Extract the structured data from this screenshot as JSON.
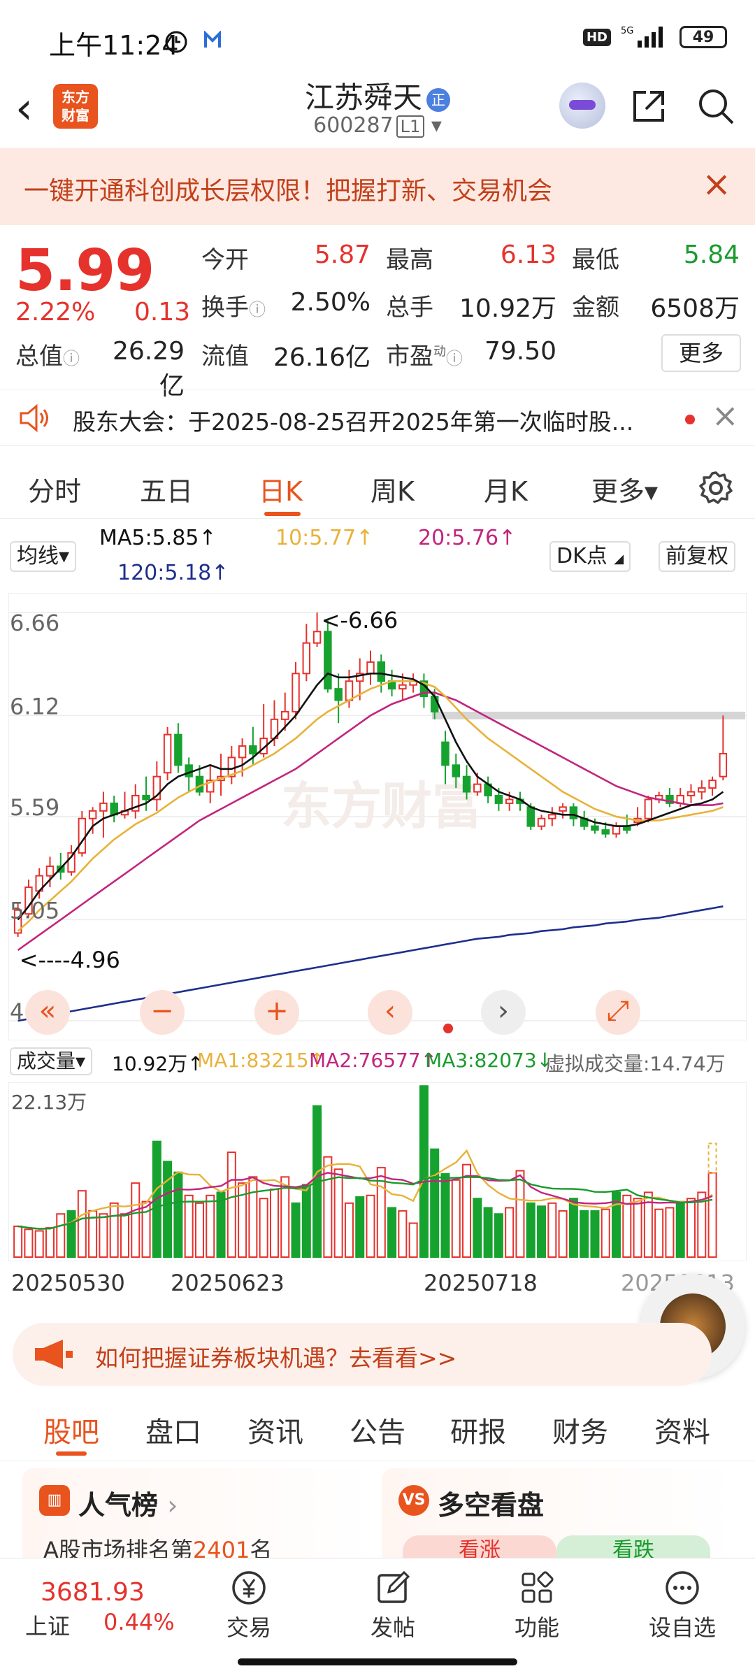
{
  "status_bar": {
    "time": "上午11:24",
    "hd": "HD",
    "network": "5G",
    "battery": "49"
  },
  "header": {
    "back": "‹",
    "logo_line1": "东方",
    "logo_line2": "财富",
    "stock_name": "江苏舜天",
    "badge": "正",
    "stock_code": "600287",
    "level": "L1"
  },
  "promo": {
    "text": "一键开通科创成长层权限！把握打新、交易机会",
    "close": "×"
  },
  "quote": {
    "price": "5.99",
    "change_pct": "2.22%",
    "change": "0.13",
    "open_label": "今开",
    "open": "5.87",
    "high_label": "最高",
    "high": "6.13",
    "low_label": "最低",
    "low": "5.84",
    "turnover_label": "换手",
    "turnover": "2.50%",
    "volume_label": "总手",
    "volume": "10.92万",
    "amount_label": "金额",
    "amount": "6508万",
    "mktcap_label": "总值",
    "mktcap": "26.29亿",
    "float_label": "流值",
    "float": "26.16亿",
    "pe_label": "市盈",
    "pe_sup": "动",
    "pe": "79.50",
    "more": "更多"
  },
  "announcement": {
    "text": "股东大会：于2025-08-25召开2025年第一次临时股...",
    "close": "×"
  },
  "chart_tabs": [
    "分时",
    "五日",
    "日K",
    "周K",
    "月K",
    "更多▾"
  ],
  "ma_legend": {
    "selector": "均线▾",
    "ma5": "MA5:5.85↑",
    "ma10": "10:5.77↑",
    "ma20": "20:5.76↑",
    "ma120": "120:5.18↑",
    "dk": "DK点",
    "adjust": "前复权",
    "colors": {
      "ma5": "#111111",
      "ma10": "#e8b23a",
      "ma20": "#c2257e",
      "ma120": "#1e2f8c"
    }
  },
  "chart_data": {
    "type": "candlestick",
    "y_ticks": [
      "6.66",
      "6.12",
      "5.59",
      "5.05",
      "4.52"
    ],
    "ylim": [
      4.52,
      6.66
    ],
    "max_label": "6.66",
    "min_label": "4.96",
    "candles": [
      [
        4.98,
        5.1,
        5.14,
        4.96
      ],
      [
        5.08,
        5.22,
        5.26,
        5.06
      ],
      [
        5.2,
        5.28,
        5.32,
        5.16
      ],
      [
        5.28,
        5.33,
        5.38,
        5.22
      ],
      [
        5.33,
        5.3,
        5.4,
        5.26
      ],
      [
        5.3,
        5.4,
        5.44,
        5.28
      ],
      [
        5.4,
        5.58,
        5.62,
        5.38
      ],
      [
        5.58,
        5.62,
        5.64,
        5.5
      ],
      [
        5.62,
        5.66,
        5.72,
        5.48
      ],
      [
        5.66,
        5.6,
        5.7,
        5.56
      ],
      [
        5.6,
        5.62,
        5.72,
        5.58
      ],
      [
        5.62,
        5.7,
        5.76,
        5.58
      ],
      [
        5.7,
        5.68,
        5.8,
        5.62
      ],
      [
        5.68,
        5.8,
        5.88,
        5.62
      ],
      [
        5.82,
        6.02,
        6.06,
        5.78
      ],
      [
        6.02,
        5.86,
        6.08,
        5.82
      ],
      [
        5.86,
        5.8,
        5.9,
        5.72
      ],
      [
        5.8,
        5.72,
        5.86,
        5.7
      ],
      [
        5.72,
        5.78,
        5.86,
        5.66
      ],
      [
        5.78,
        5.8,
        5.92,
        5.7
      ],
      [
        5.8,
        5.9,
        5.96,
        5.76
      ],
      [
        5.9,
        5.96,
        6.0,
        5.8
      ],
      [
        5.96,
        5.92,
        6.06,
        5.86
      ],
      [
        5.92,
        6.0,
        6.18,
        5.9
      ],
      [
        6.0,
        6.1,
        6.2,
        5.96
      ],
      [
        6.1,
        6.14,
        6.24,
        6.04
      ],
      [
        6.14,
        6.34,
        6.4,
        6.1
      ],
      [
        6.34,
        6.5,
        6.6,
        6.3
      ],
      [
        6.5,
        6.56,
        6.66,
        6.48
      ],
      [
        6.56,
        6.26,
        6.62,
        6.24
      ],
      [
        6.26,
        6.2,
        6.34,
        6.08
      ],
      [
        6.2,
        6.3,
        6.36,
        6.16
      ],
      [
        6.3,
        6.34,
        6.42,
        6.2
      ],
      [
        6.34,
        6.4,
        6.46,
        6.28
      ],
      [
        6.4,
        6.3,
        6.44,
        6.24
      ],
      [
        6.3,
        6.26,
        6.36,
        6.22
      ],
      [
        6.26,
        6.28,
        6.34,
        6.2
      ],
      [
        6.28,
        6.3,
        6.34,
        6.24
      ],
      [
        6.3,
        6.22,
        6.34,
        6.16
      ],
      [
        6.22,
        6.14,
        6.26,
        6.1
      ],
      [
        5.98,
        5.86,
        6.04,
        5.76
      ],
      [
        5.86,
        5.8,
        5.92,
        5.74
      ],
      [
        5.8,
        5.72,
        5.86,
        5.68
      ],
      [
        5.72,
        5.76,
        5.82,
        5.7
      ],
      [
        5.76,
        5.7,
        5.8,
        5.66
      ],
      [
        5.7,
        5.66,
        5.74,
        5.62
      ],
      [
        5.66,
        5.68,
        5.72,
        5.62
      ],
      [
        5.68,
        5.66,
        5.72,
        5.62
      ],
      [
        5.64,
        5.54,
        5.66,
        5.52
      ],
      [
        5.54,
        5.58,
        5.6,
        5.52
      ],
      [
        5.58,
        5.6,
        5.64,
        5.54
      ],
      [
        5.62,
        5.64,
        5.66,
        5.58
      ],
      [
        5.64,
        5.58,
        5.66,
        5.54
      ],
      [
        5.58,
        5.54,
        5.62,
        5.52
      ],
      [
        5.54,
        5.52,
        5.58,
        5.5
      ],
      [
        5.52,
        5.5,
        5.56,
        5.48
      ],
      [
        5.5,
        5.54,
        5.56,
        5.48
      ],
      [
        5.54,
        5.52,
        5.6,
        5.5
      ],
      [
        5.56,
        5.58,
        5.64,
        5.54
      ],
      [
        5.58,
        5.68,
        5.7,
        5.56
      ],
      [
        5.68,
        5.7,
        5.72,
        5.66
      ],
      [
        5.7,
        5.66,
        5.74,
        5.64
      ],
      [
        5.66,
        5.7,
        5.74,
        5.64
      ],
      [
        5.7,
        5.72,
        5.76,
        5.66
      ],
      [
        5.72,
        5.74,
        5.78,
        5.68
      ],
      [
        5.74,
        5.78,
        5.8,
        5.7
      ],
      [
        5.8,
        5.92,
        6.12,
        5.78
      ]
    ],
    "ma5": [
      5.05,
      5.12,
      5.2,
      5.26,
      5.32,
      5.38,
      5.46,
      5.54,
      5.58,
      5.6,
      5.62,
      5.64,
      5.66,
      5.7,
      5.76,
      5.8,
      5.82,
      5.84,
      5.86,
      5.84,
      5.84,
      5.86,
      5.9,
      5.95,
      6.0,
      6.06,
      6.12,
      6.2,
      6.28,
      6.34,
      6.32,
      6.32,
      6.33,
      6.34,
      6.34,
      6.33,
      6.32,
      6.31,
      6.28,
      6.22,
      6.1,
      5.98,
      5.88,
      5.8,
      5.76,
      5.72,
      5.7,
      5.68,
      5.64,
      5.62,
      5.61,
      5.6,
      5.6,
      5.58,
      5.56,
      5.55,
      5.54,
      5.54,
      5.55,
      5.57,
      5.59,
      5.61,
      5.63,
      5.65,
      5.66,
      5.68,
      5.72
    ],
    "ma10": [
      4.99,
      5.04,
      5.1,
      5.15,
      5.2,
      5.25,
      5.31,
      5.37,
      5.42,
      5.47,
      5.51,
      5.55,
      5.58,
      5.61,
      5.65,
      5.69,
      5.72,
      5.75,
      5.77,
      5.79,
      5.81,
      5.83,
      5.86,
      5.89,
      5.92,
      5.96,
      6.0,
      6.05,
      6.1,
      6.14,
      6.17,
      6.2,
      6.23,
      6.26,
      6.28,
      6.3,
      6.3,
      6.3,
      6.29,
      6.27,
      6.22,
      6.16,
      6.1,
      6.05,
      6.0,
      5.96,
      5.92,
      5.88,
      5.84,
      5.8,
      5.76,
      5.72,
      5.69,
      5.66,
      5.63,
      5.61,
      5.59,
      5.58,
      5.57,
      5.57,
      5.57,
      5.58,
      5.59,
      5.6,
      5.61,
      5.62,
      5.64
    ],
    "ma20": [
      4.89,
      4.93,
      4.97,
      5.01,
      5.05,
      5.09,
      5.13,
      5.17,
      5.21,
      5.25,
      5.29,
      5.33,
      5.37,
      5.41,
      5.45,
      5.49,
      5.53,
      5.57,
      5.6,
      5.63,
      5.66,
      5.69,
      5.72,
      5.75,
      5.78,
      5.81,
      5.84,
      5.88,
      5.92,
      5.96,
      6.0,
      6.04,
      6.08,
      6.12,
      6.15,
      6.18,
      6.2,
      6.22,
      6.24,
      6.24,
      6.22,
      6.2,
      6.17,
      6.14,
      6.11,
      6.08,
      6.05,
      6.02,
      5.99,
      5.96,
      5.93,
      5.9,
      5.87,
      5.84,
      5.81,
      5.78,
      5.75,
      5.73,
      5.71,
      5.69,
      5.68,
      5.67,
      5.66,
      5.65,
      5.65,
      5.65,
      5.66
    ],
    "ma120": [
      4.52,
      4.53,
      4.54,
      4.55,
      4.56,
      4.57,
      4.58,
      4.59,
      4.6,
      4.61,
      4.62,
      4.63,
      4.64,
      4.65,
      4.66,
      4.67,
      4.68,
      4.69,
      4.7,
      4.71,
      4.72,
      4.73,
      4.74,
      4.75,
      4.76,
      4.77,
      4.78,
      4.79,
      4.8,
      4.81,
      4.82,
      4.83,
      4.84,
      4.85,
      4.86,
      4.87,
      4.88,
      4.89,
      4.9,
      4.91,
      4.92,
      4.93,
      4.94,
      4.95,
      4.955,
      4.96,
      4.97,
      4.975,
      4.98,
      4.99,
      4.995,
      5.0,
      5.01,
      5.015,
      5.02,
      5.03,
      5.035,
      5.04,
      5.05,
      5.055,
      5.06,
      5.07,
      5.08,
      5.09,
      5.1,
      5.11,
      5.12
    ],
    "resistance_band": [
      6.1,
      6.14
    ]
  },
  "volume_legend": {
    "selector": "成交量▾",
    "vol": "10.92万↑",
    "ma1": "MA1:83215↑",
    "ma2": "MA2:76577↑",
    "ma3": "MA3:82073↓",
    "virtual": "虚拟成交量:14.74万",
    "max_label": "22.13万"
  },
  "volume_data": {
    "ylim": [
      0,
      221300
    ],
    "values": [
      40000,
      36000,
      34000,
      38000,
      56000,
      60000,
      86000,
      60000,
      56000,
      70000,
      56000,
      96000,
      72000,
      150000,
      124000,
      110000,
      80000,
      70000,
      80000,
      84000,
      136000,
      96000,
      104000,
      76000,
      88000,
      104000,
      70000,
      94000,
      196000,
      130000,
      114000,
      70000,
      78000,
      80000,
      116000,
      64000,
      60000,
      44000,
      222000,
      140000,
      108000,
      100000,
      120000,
      76000,
      64000,
      56000,
      64000,
      112000,
      70000,
      66000,
      70000,
      60000,
      76000,
      60000,
      60000,
      62000,
      84000,
      80000,
      76000,
      84000,
      62000,
      64000,
      72000,
      76000,
      84000,
      109200
    ],
    "up": [
      1,
      1,
      1,
      1,
      1,
      0,
      1,
      1,
      1,
      1,
      1,
      1,
      1,
      0,
      0,
      0,
      1,
      1,
      1,
      0,
      1,
      1,
      1,
      1,
      1,
      1,
      0,
      0,
      0,
      1,
      1,
      1,
      0,
      1,
      1,
      0,
      1,
      1,
      0,
      0,
      0,
      1,
      1,
      0,
      0,
      0,
      1,
      1,
      0,
      0,
      1,
      1,
      0,
      0,
      0,
      1,
      0,
      1,
      1,
      1,
      1,
      1,
      0,
      1,
      1,
      1
    ],
    "virtual_bar": 147400
  },
  "dates": [
    "20250530",
    "20250623",
    "20250718",
    "20250813"
  ],
  "ad": {
    "text": "如何把握证券板块机遇？去看看>>"
  },
  "info_tabs": [
    "股吧",
    "盘口",
    "资讯",
    "公告",
    "研报",
    "财务",
    "资料"
  ],
  "cards": {
    "popularity": {
      "title": "人气榜",
      "sub_prefix": "A股市场排名第",
      "rank": "2401",
      "sub_suffix": "名"
    },
    "bull_bear": {
      "title": "多空看盘",
      "up": "看涨",
      "down": "看跌"
    }
  },
  "bottom_nav": {
    "index_value": "3681.93",
    "index_name": "上证",
    "index_pct": "0.44%",
    "items": [
      "交易",
      "发帖",
      "功能",
      "设自选"
    ]
  }
}
